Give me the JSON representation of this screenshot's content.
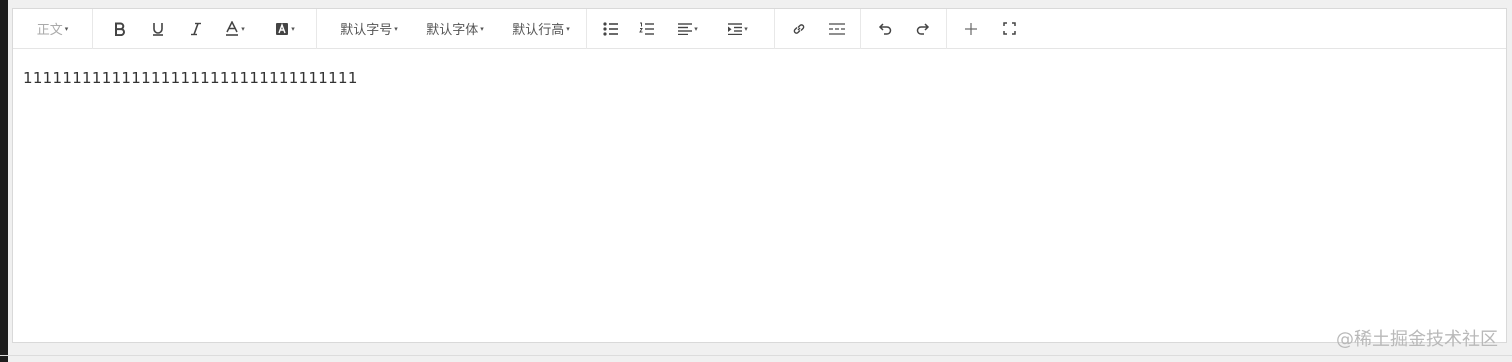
{
  "toolbar": {
    "heading": "正文",
    "font_size": "默认字号",
    "font_family": "默认字体",
    "line_height": "默认行高",
    "dropdown_caret": "▾"
  },
  "content": {
    "text": "1111111111111111111111111111111111"
  },
  "watermark": "@稀土掘金技术社区"
}
